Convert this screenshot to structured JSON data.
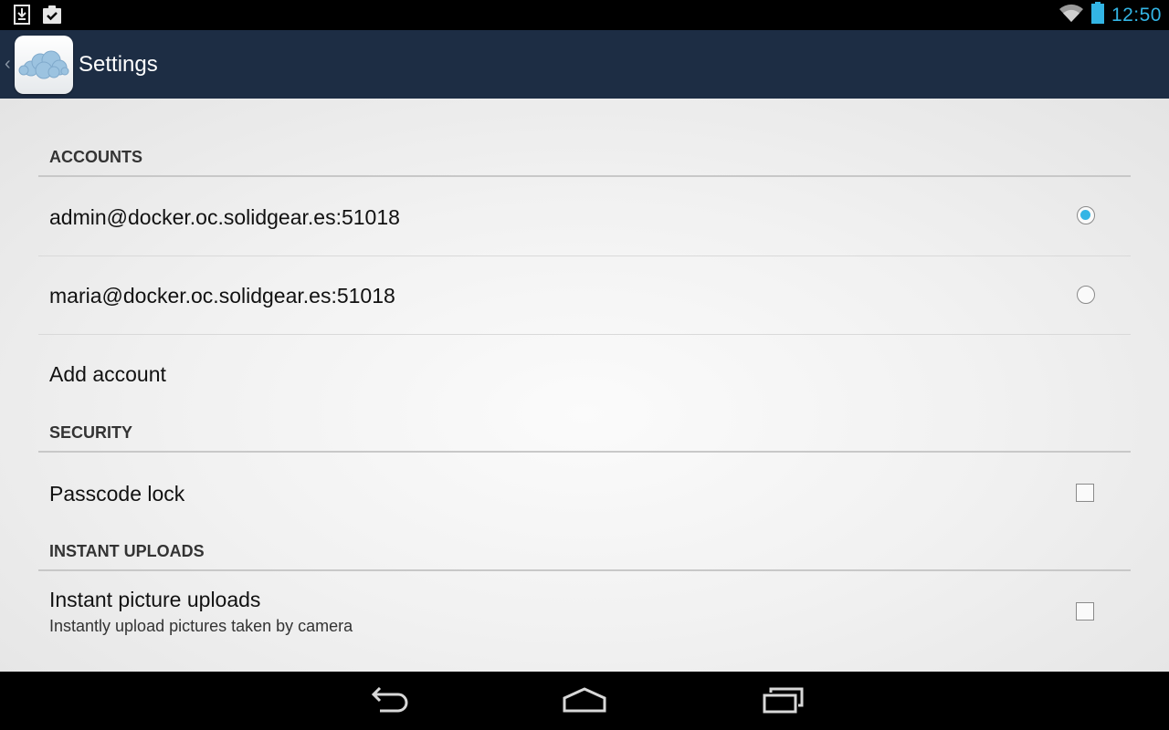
{
  "status_bar": {
    "time": "12:50",
    "left_icons": [
      "download-icon",
      "clipboard-check-icon"
    ],
    "right_icons": [
      "wifi-icon",
      "battery-icon"
    ]
  },
  "action_bar": {
    "title": "Settings",
    "logo_icon": "owncloud-logo-icon"
  },
  "sections": {
    "accounts": {
      "header": "ACCOUNTS",
      "items": [
        {
          "label": "admin@docker.oc.solidgear.es:51018",
          "selected": true
        },
        {
          "label": "maria@docker.oc.solidgear.es:51018",
          "selected": false
        }
      ],
      "add_account": "Add account"
    },
    "security": {
      "header": "SECURITY",
      "passcode_label": "Passcode lock",
      "passcode_checked": false
    },
    "instant_uploads": {
      "header": "INSTANT UPLOADS",
      "picture_label": "Instant picture uploads",
      "picture_summary": "Instantly upload pictures taken by camera",
      "picture_checked": false
    }
  },
  "nav_bar": {
    "buttons": [
      "back-icon",
      "home-icon",
      "recent-apps-icon"
    ]
  },
  "colors": {
    "accent": "#33b5e5",
    "action_bar": "#1d2d44"
  }
}
